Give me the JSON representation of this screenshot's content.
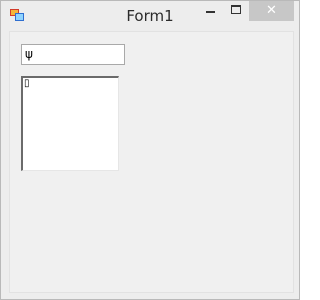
{
  "window": {
    "title": "Form1",
    "controls": {
      "minimize_icon": "minimize-icon",
      "maximize_icon": "maximize-icon",
      "close_glyph": "✕",
      "close_color": "#c7c7c7"
    },
    "app_icon": "form-app-icon"
  },
  "form": {
    "textbox_value": "ψ",
    "textarea_value": "▯"
  }
}
